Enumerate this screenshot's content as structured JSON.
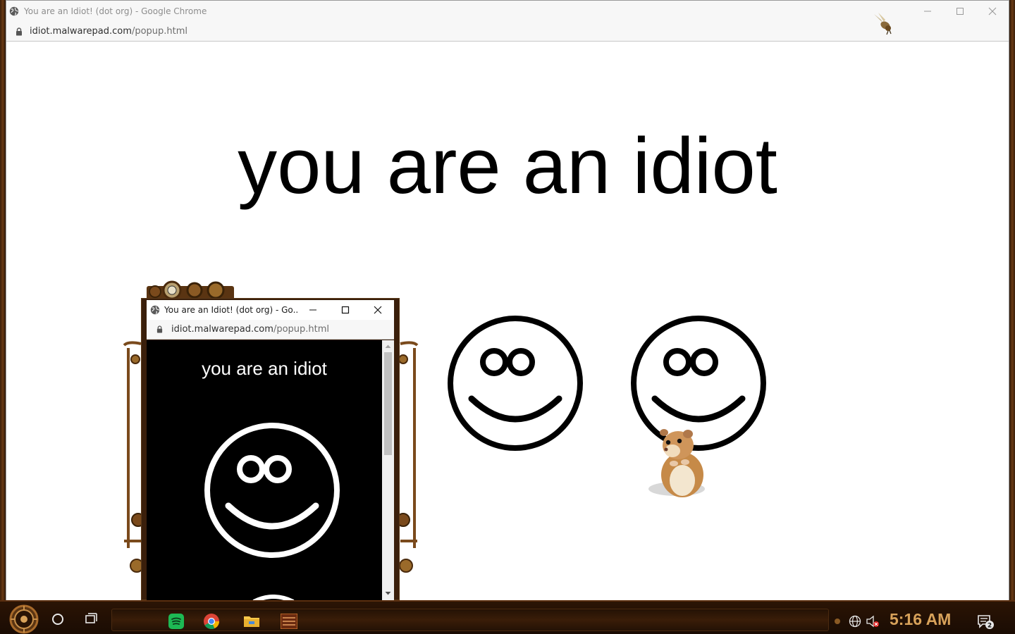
{
  "main_window": {
    "title": "You are an Idiot! (dot org) - Google Chrome",
    "url_domain": "idiot.malwarepad.com",
    "url_path": "/popup.html",
    "headline": "you are an idiot"
  },
  "popup_window": {
    "title": "You are an Idiot! (dot org) - Go...",
    "url_domain": "idiot.malwarepad.com",
    "url_path": "/popup.html",
    "headline": "you are an idiot"
  },
  "window_controls": [
    "minimize-icon",
    "maximize-icon",
    "close-icon"
  ],
  "taskbar": {
    "apps": [
      "start-orb-icon",
      "cortana-icon",
      "task-view-icon",
      "spotify-icon",
      "chrome-icon",
      "file-explorer-icon",
      "steampunk-app-icon"
    ],
    "tray": [
      "network-icon",
      "volume-muted-icon"
    ],
    "clock": "5:16 AM",
    "notification_count": "2"
  },
  "colors": {
    "page_background": "#ffffff",
    "popup_page_background": "#000000",
    "clock_color": "#d8a25a",
    "taskbar_background": "#1a0c03"
  }
}
